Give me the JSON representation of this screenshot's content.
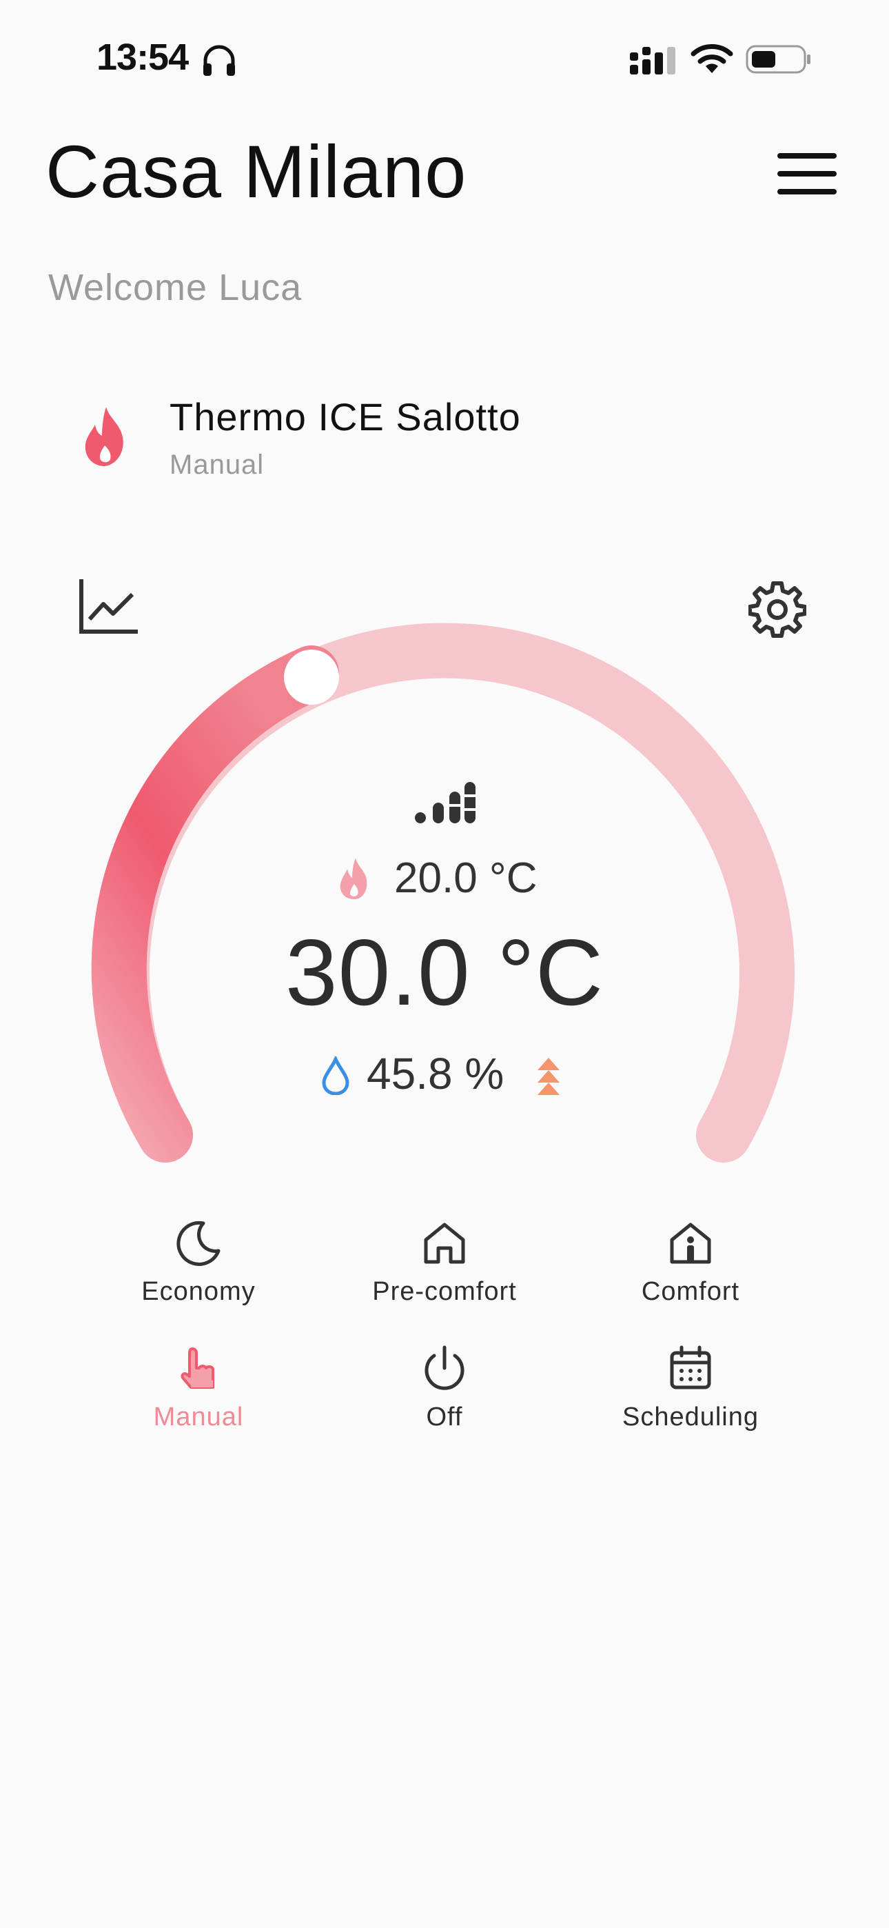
{
  "status_bar": {
    "time": "13:54"
  },
  "header": {
    "title": "Casa Milano",
    "welcome": "Welcome Luca"
  },
  "device": {
    "name": "Thermo ICE Salotto",
    "mode": "Manual"
  },
  "dial": {
    "setpoint": "20.0 °C",
    "current_temperature": "30.0 °C",
    "humidity": "45.8 %"
  },
  "modes": [
    {
      "label": "Economy",
      "icon": "moon-icon",
      "active": false
    },
    {
      "label": "Pre-comfort",
      "icon": "home-icon",
      "active": false
    },
    {
      "label": "Comfort",
      "icon": "home-person-icon",
      "active": false
    },
    {
      "label": "Manual",
      "icon": "hand-pointer-icon",
      "active": true
    },
    {
      "label": "Off",
      "icon": "power-icon",
      "active": false
    },
    {
      "label": "Scheduling",
      "icon": "calendar-icon",
      "active": false
    }
  ],
  "colors": {
    "accent": "#ef5a6f",
    "accent_light": "#f5c4cb",
    "active_label": "#ef8a96",
    "humidity_blue": "#3a8ee6",
    "trend_orange": "#f5956b"
  }
}
